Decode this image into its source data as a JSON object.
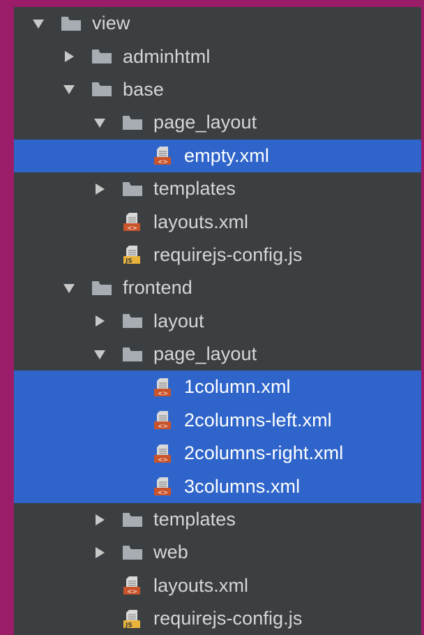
{
  "colors": {
    "page_border": "#9b1d6a",
    "panel_background": "#3c3f41",
    "selection": "#2f65ca",
    "text": "#d6d6d6",
    "text_selected": "#ffffff",
    "folder": "#a7adb2",
    "xml_icon_accent": "#c9532b",
    "js_icon_accent": "#e9b339"
  },
  "tree": [
    {
      "label": "view",
      "depth": 0,
      "kind": "folder",
      "expanded": true,
      "selected": false,
      "icon": "folder-icon"
    },
    {
      "label": "adminhtml",
      "depth": 1,
      "kind": "folder",
      "expanded": false,
      "selected": false,
      "icon": "folder-icon"
    },
    {
      "label": "base",
      "depth": 1,
      "kind": "folder",
      "expanded": true,
      "selected": false,
      "icon": "folder-icon"
    },
    {
      "label": "page_layout",
      "depth": 2,
      "kind": "folder",
      "expanded": true,
      "selected": false,
      "icon": "folder-icon"
    },
    {
      "label": "empty.xml",
      "depth": 3,
      "kind": "xml",
      "selected": true,
      "icon": "xml-file-icon"
    },
    {
      "label": "templates",
      "depth": 2,
      "kind": "folder",
      "expanded": false,
      "selected": false,
      "icon": "folder-icon"
    },
    {
      "label": "layouts.xml",
      "depth": 2,
      "kind": "xml",
      "selected": false,
      "icon": "xml-file-icon"
    },
    {
      "label": "requirejs-config.js",
      "depth": 2,
      "kind": "js",
      "selected": false,
      "icon": "js-file-icon"
    },
    {
      "label": "frontend",
      "depth": 1,
      "kind": "folder",
      "expanded": true,
      "selected": false,
      "icon": "folder-icon"
    },
    {
      "label": "layout",
      "depth": 2,
      "kind": "folder",
      "expanded": false,
      "selected": false,
      "icon": "folder-icon"
    },
    {
      "label": "page_layout",
      "depth": 2,
      "kind": "folder",
      "expanded": true,
      "selected": false,
      "icon": "folder-icon"
    },
    {
      "label": "1column.xml",
      "depth": 3,
      "kind": "xml",
      "selected": true,
      "icon": "xml-file-icon"
    },
    {
      "label": "2columns-left.xml",
      "depth": 3,
      "kind": "xml",
      "selected": true,
      "icon": "xml-file-icon"
    },
    {
      "label": "2columns-right.xml",
      "depth": 3,
      "kind": "xml",
      "selected": true,
      "icon": "xml-file-icon"
    },
    {
      "label": "3columns.xml",
      "depth": 3,
      "kind": "xml",
      "selected": true,
      "icon": "xml-file-icon"
    },
    {
      "label": "templates",
      "depth": 2,
      "kind": "folder",
      "expanded": false,
      "selected": false,
      "icon": "folder-icon"
    },
    {
      "label": "web",
      "depth": 2,
      "kind": "folder",
      "expanded": false,
      "selected": false,
      "icon": "folder-icon"
    },
    {
      "label": "layouts.xml",
      "depth": 2,
      "kind": "xml",
      "selected": false,
      "icon": "xml-file-icon"
    },
    {
      "label": "requirejs-config.js",
      "depth": 2,
      "kind": "js",
      "selected": false,
      "icon": "js-file-icon"
    }
  ]
}
